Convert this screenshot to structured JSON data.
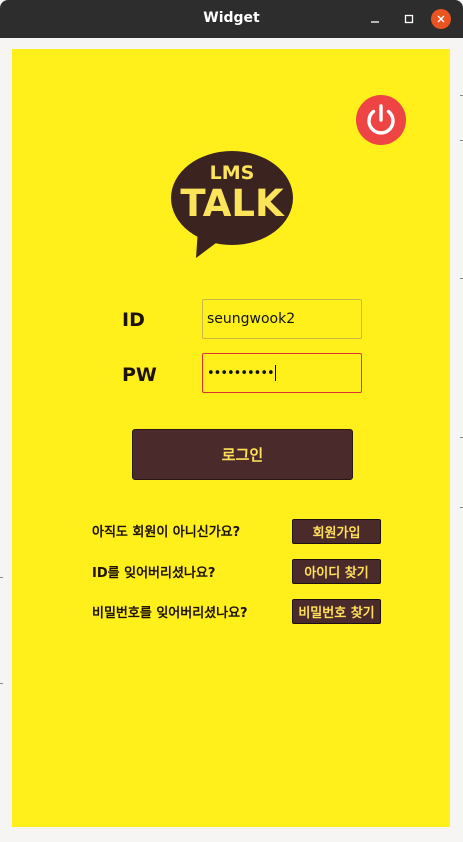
{
  "window": {
    "title": "Widget"
  },
  "logo": {
    "line1": "LMS",
    "line2": "TALK"
  },
  "form": {
    "id_label": "ID",
    "pw_label": "PW",
    "id_value": "seungwook2",
    "pw_value": "••••••••••"
  },
  "login_button": "로그인",
  "help": {
    "signup_question": "아직도 회원이 아니신가요?",
    "signup_button": "회원가입",
    "find_id_question": "ID를 잊어버리셨나요?",
    "find_id_button": "아이디 찾기",
    "find_pw_question": "비밀번호를 잊어버리셨나요?",
    "find_pw_button": "비밀번호 찾기"
  },
  "colors": {
    "panel_bg": "#fff01c",
    "button_bg": "#4a2a2a",
    "button_text": "#ffe05a",
    "logo_bubble": "#3b2320",
    "power_red": "#ef4444",
    "titlebar": "#2d2d2d",
    "close_orange": "#e95420"
  },
  "icons": {
    "minimize": "minimize-icon",
    "maximize": "maximize-icon",
    "close": "close-icon",
    "power": "power-icon"
  }
}
